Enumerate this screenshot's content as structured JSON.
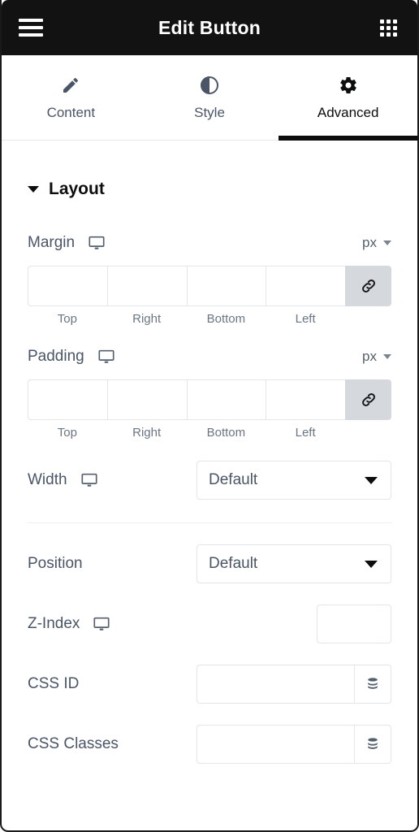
{
  "header": {
    "title": "Edit Button",
    "menu_icon": "hamburger-menu-icon",
    "apps_icon": "grid-apps-icon"
  },
  "tabs": [
    {
      "label": "Content",
      "icon": "pencil-icon",
      "active": false
    },
    {
      "label": "Style",
      "icon": "contrast-icon",
      "active": false
    },
    {
      "label": "Advanced",
      "icon": "gear-icon",
      "active": true
    }
  ],
  "section": {
    "title": "Layout",
    "collapsed": false,
    "caret_icon": "caret-down-icon"
  },
  "controls": {
    "margin": {
      "label": "Margin",
      "device_icon": "desktop-monitor-icon",
      "unit": "px",
      "unit_caret_icon": "chevron-down-icon",
      "link_icon": "link-chain-icon",
      "values": [
        "",
        "",
        "",
        ""
      ],
      "side_labels": [
        "Top",
        "Right",
        "Bottom",
        "Left"
      ]
    },
    "padding": {
      "label": "Padding",
      "device_icon": "desktop-monitor-icon",
      "unit": "px",
      "unit_caret_icon": "chevron-down-icon",
      "link_icon": "link-chain-icon",
      "values": [
        "",
        "",
        "",
        ""
      ],
      "side_labels": [
        "Top",
        "Right",
        "Bottom",
        "Left"
      ]
    },
    "width": {
      "label": "Width",
      "device_icon": "desktop-monitor-icon",
      "value": "Default",
      "caret_icon": "caret-down-icon"
    },
    "position": {
      "label": "Position",
      "value": "Default",
      "caret_icon": "caret-down-icon"
    },
    "zindex": {
      "label": "Z-Index",
      "device_icon": "desktop-monitor-icon",
      "value": ""
    },
    "css_id": {
      "label": "CSS ID",
      "value": "",
      "action_icon": "dynamic-tags-database-icon"
    },
    "css_classes": {
      "label": "CSS Classes",
      "value": "",
      "action_icon": "dynamic-tags-database-icon"
    }
  },
  "colors": {
    "header_bg": "#121212",
    "active_tab": "#0c0d0e",
    "label": "#4a5568",
    "border": "#e2e5e9",
    "link_btn_bg": "#d5d8dc"
  }
}
